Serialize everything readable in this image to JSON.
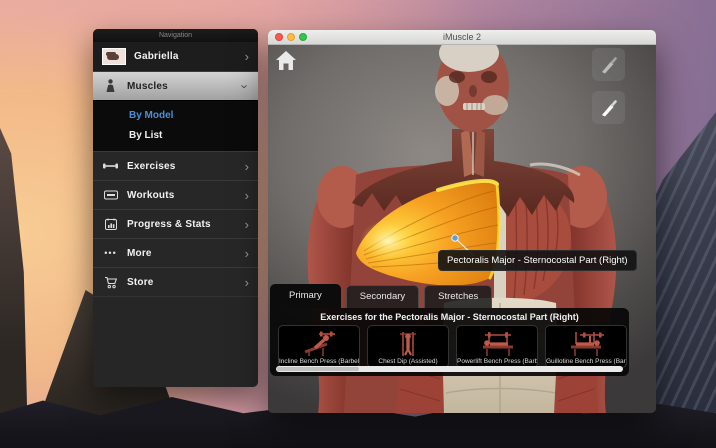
{
  "colors": {
    "accent_blue": "#4a90d8",
    "muscle_highlight_orange": "#f7a122",
    "traffic_red": "#fc5753",
    "traffic_yellow": "#fdbc40",
    "traffic_green": "#33c748"
  },
  "nav": {
    "title": "Navigation",
    "user": {
      "label": "Gabriella"
    },
    "sections": [
      {
        "label": "Muscles"
      },
      {
        "label": "Exercises"
      },
      {
        "label": "Workouts"
      },
      {
        "label": "Progress & Stats"
      },
      {
        "label": "More"
      },
      {
        "label": "Store"
      }
    ],
    "muscles_sub": [
      {
        "label": "By Model"
      },
      {
        "label": "By List"
      }
    ]
  },
  "app_window": {
    "title": "iMuscle 2",
    "selection_tooltip": "Pectoralis Major - Sternocostal Part (Right)",
    "tabs": [
      {
        "label": "Primary"
      },
      {
        "label": "Secondary"
      },
      {
        "label": "Stretches"
      }
    ],
    "exercises_header": "Exercises for the Pectoralis Major - Sternocostal Part (Right)",
    "exercises": [
      {
        "label": "Incline Bench Press (Barbell)"
      },
      {
        "label": "Chest Dip (Assisted)"
      },
      {
        "label": "Powerlift Bench Press (Barbell)"
      },
      {
        "label": "Guillotine Bench Press (Barbell)"
      }
    ]
  },
  "icons": {
    "chevron_right": "›",
    "chevron_down": "›",
    "more_dots": "•••"
  }
}
